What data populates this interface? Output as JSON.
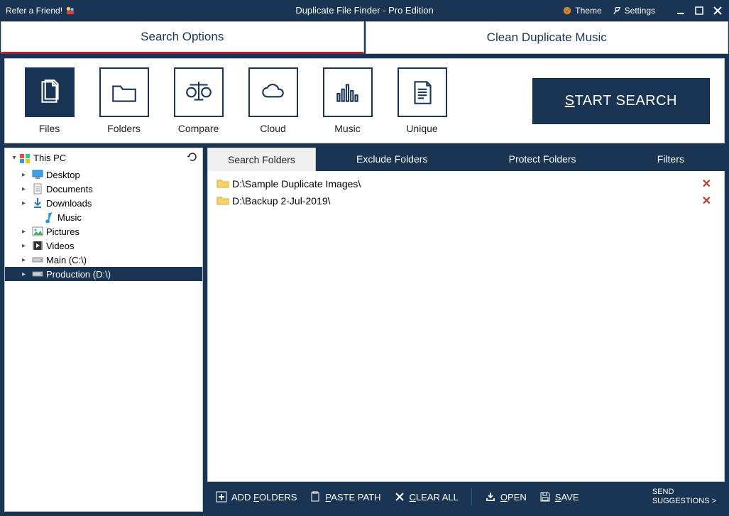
{
  "title": "Duplicate File Finder - Pro Edition",
  "titlebar": {
    "refer": "Refer a Friend!",
    "theme": "Theme",
    "settings": "Settings"
  },
  "main_tabs": {
    "search_options": "Search Options",
    "clean_music": "Clean Duplicate Music"
  },
  "modes": {
    "files": "Files",
    "folders": "Folders",
    "compare": "Compare",
    "cloud": "Cloud",
    "music": "Music",
    "unique": "Unique"
  },
  "start_search": {
    "prefix": "S",
    "rest": "TART SEARCH"
  },
  "tree": {
    "root": "This PC",
    "items": [
      {
        "label": "Desktop"
      },
      {
        "label": "Documents"
      },
      {
        "label": "Downloads"
      },
      {
        "label": "Music"
      },
      {
        "label": "Pictures"
      },
      {
        "label": "Videos"
      },
      {
        "label": "Main (C:\\)"
      },
      {
        "label": "Production (D:\\)",
        "selected": true
      }
    ]
  },
  "sub_tabs": {
    "search_folders": "Search Folders",
    "exclude_folders": "Exclude Folders",
    "protect_folders": "Protect Folders",
    "filters": "Filters"
  },
  "folders": [
    {
      "path": "D:\\Sample Duplicate Images\\"
    },
    {
      "path": "D:\\Backup 2-Jul-2019\\"
    }
  ],
  "bottom": {
    "add_folders": {
      "prefix": "ADD ",
      "u": "F",
      "rest": "OLDERS"
    },
    "paste_path": {
      "prefix": "",
      "u": "P",
      "rest": "ASTE PATH"
    },
    "clear_all": {
      "prefix": "",
      "u": "C",
      "rest": "LEAR ALL"
    },
    "open": {
      "prefix": "",
      "u": "O",
      "rest": "PEN"
    },
    "save": {
      "prefix": "",
      "u": "S",
      "rest": "AVE"
    },
    "send_l1": "SEND",
    "send_l2": "SUGGESTIONS >"
  }
}
